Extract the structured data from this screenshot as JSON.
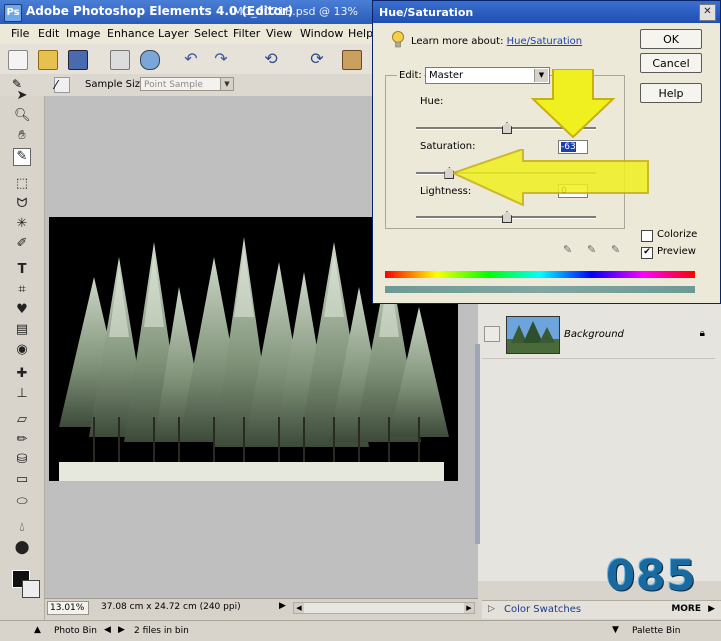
{
  "window": {
    "app_title": "Adobe Photoshop Elements 4.0 (Editor)",
    "file_title": "IMG_0071B.psd @ 13%"
  },
  "menu": [
    "File",
    "Edit",
    "Image",
    "Enhance",
    "Layer",
    "Select",
    "Filter",
    "View",
    "Window",
    "Help"
  ],
  "options_bar": {
    "sample_size_label": "Sample Size:",
    "sample_size_value": "Point Sample"
  },
  "status": {
    "zoom": "13.01%",
    "doc_size": "37.08 cm x 24.72 cm (240 ppi)"
  },
  "bottom_bar": {
    "photo_bin": "Photo Bin",
    "files_in_bin": "2 files in bin",
    "palette_bin": "Palette Bin"
  },
  "layers": {
    "layer_name": "Background"
  },
  "watermark": "085",
  "color_swatches": {
    "label": "Color Swatches",
    "more": "MORE"
  },
  "dialog": {
    "title": "Hue/Saturation",
    "learn_text": "Learn more about:",
    "learn_link": "Hue/Saturation",
    "ok": "OK",
    "cancel": "Cancel",
    "help": "Help",
    "edit_label": "Edit:",
    "edit_value": "Master",
    "hue_label": "Hue:",
    "hue_value": "",
    "saturation_label": "Saturation:",
    "saturation_value": "-63",
    "lightness_label": "Lightness:",
    "lightness_value": "0",
    "colorize_label": "Colorize",
    "colorize_checked": false,
    "preview_label": "Preview",
    "preview_checked": true,
    "slider_levels": {
      "hue": 0.5,
      "saturation": 0.18,
      "lightness": 0.5
    }
  }
}
